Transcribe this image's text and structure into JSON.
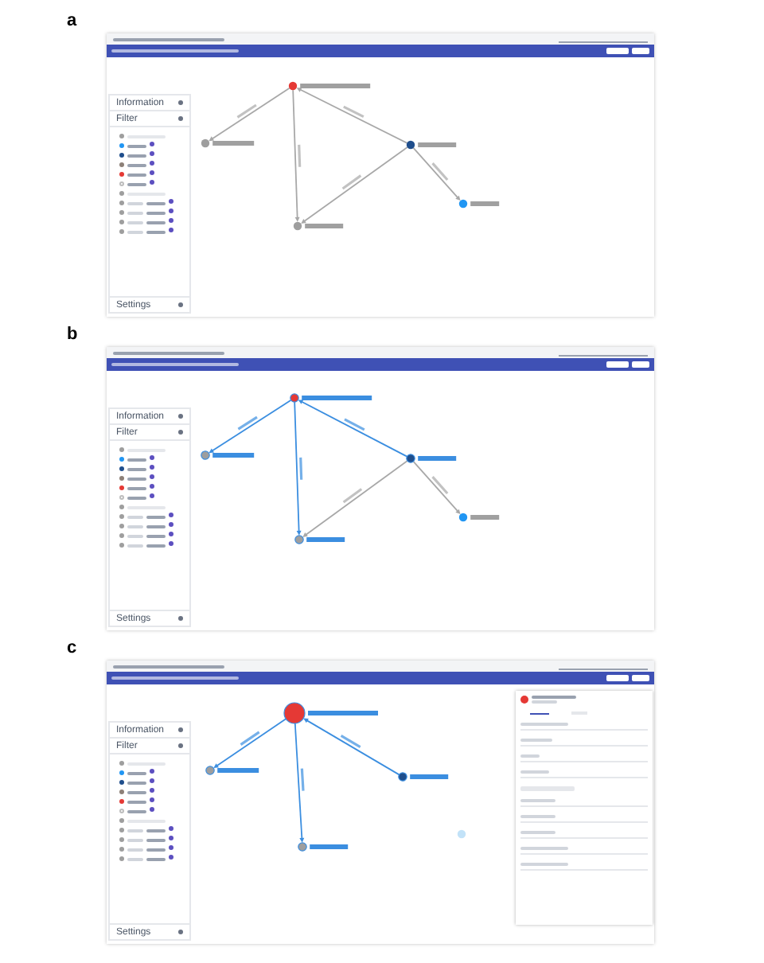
{
  "panels": [
    {
      "label": "a",
      "sidebar": {
        "information": "Information",
        "filter": "Filter",
        "settings": "Settings"
      },
      "graph": {
        "nodes": [
          {
            "color": "#e53935",
            "selected": false,
            "highlighted": false
          },
          {
            "color": "#9e9e9e",
            "selected": false,
            "highlighted": false
          },
          {
            "color": "#1f4e8c",
            "selected": false,
            "highlighted": false
          },
          {
            "color": "#2196f3",
            "selected": false,
            "highlighted": false
          },
          {
            "color": "#9e9e9e",
            "selected": false,
            "highlighted": false
          }
        ],
        "edges": [
          {
            "highlighted": false
          },
          {
            "highlighted": false
          },
          {
            "highlighted": false
          },
          {
            "highlighted": false
          },
          {
            "highlighted": false
          }
        ]
      }
    },
    {
      "label": "b",
      "sidebar": {
        "information": "Information",
        "filter": "Filter",
        "settings": "Settings"
      },
      "graph": {
        "nodes": [
          {
            "color": "#e53935",
            "selected": false,
            "highlighted": true
          },
          {
            "color": "#9e9e9e",
            "selected": false,
            "highlighted": true
          },
          {
            "color": "#1f4e8c",
            "selected": false,
            "highlighted": true
          },
          {
            "color": "#2196f3",
            "selected": false,
            "highlighted": false
          },
          {
            "color": "#9e9e9e",
            "selected": false,
            "highlighted": true
          }
        ],
        "edges": [
          {
            "highlighted": true
          },
          {
            "highlighted": true
          },
          {
            "highlighted": true
          },
          {
            "highlighted": false
          },
          {
            "highlighted": false
          }
        ]
      }
    },
    {
      "label": "c",
      "sidebar": {
        "information": "Information",
        "filter": "Filter",
        "settings": "Settings"
      },
      "graph": {
        "nodes": [
          {
            "color": "#e53935",
            "selected": true,
            "highlighted": true
          },
          {
            "color": "#9e9e9e",
            "selected": false,
            "highlighted": true
          },
          {
            "color": "#1f4e8c",
            "selected": false,
            "highlighted": true
          },
          {
            "color": "#c2e2f8",
            "selected": false,
            "faded": true
          },
          {
            "color": "#9e9e9e",
            "selected": false,
            "highlighted": true
          }
        ],
        "edges": [
          {
            "highlighted": true
          },
          {
            "highlighted": true
          },
          {
            "highlighted": true
          }
        ]
      },
      "detail_panel": {
        "open": true
      }
    }
  ],
  "filters": [
    {
      "kind": "header",
      "color": "#9e9e9e"
    },
    {
      "kind": "node",
      "color": "#2196f3",
      "badge": true
    },
    {
      "kind": "node",
      "color": "#1f4e8c",
      "badge": true
    },
    {
      "kind": "node",
      "color": "#8d8078",
      "badge": true
    },
    {
      "kind": "node",
      "color": "#e53935",
      "badge": true
    },
    {
      "kind": "hollow",
      "color": "#bdbdbd",
      "badge": true
    },
    {
      "kind": "header",
      "color": "#9e9e9e"
    },
    {
      "kind": "edge",
      "color": "#9e9e9e",
      "badge": true
    },
    {
      "kind": "edge",
      "color": "#9e9e9e",
      "badge": true
    },
    {
      "kind": "edge",
      "color": "#9e9e9e",
      "badge": true
    },
    {
      "kind": "edge",
      "color": "#9e9e9e",
      "badge": true
    }
  ]
}
